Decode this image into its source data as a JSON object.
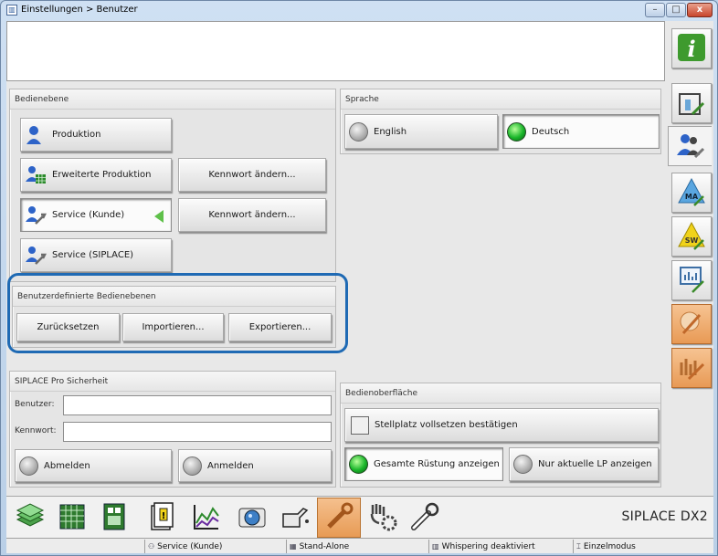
{
  "window": {
    "title": "Einstellungen > Benutzer",
    "icon": "app-icon",
    "controls": {
      "minimize": "–",
      "maximize": "□",
      "close": "x"
    }
  },
  "operator_level": {
    "title": "Bedienebene",
    "buttons": [
      {
        "label": "Produktion",
        "icon": "user-icon"
      },
      {
        "label": "Erweiterte Produktion",
        "icon": "user-grid-icon"
      },
      {
        "label": "Service (Kunde)",
        "icon": "user-wrench-icon",
        "selected": true
      },
      {
        "label": "Service (SIPLACE)",
        "icon": "user-wrench-icon"
      }
    ],
    "change_password_1": "Kennwort ändern...",
    "change_password_2": "Kennwort ändern..."
  },
  "custom_levels": {
    "title": "Benutzerdefinierte Bedienebenen",
    "reset": "Zurücksetzen",
    "import": "Importieren...",
    "export": "Exportieren..."
  },
  "language": {
    "title": "Sprache",
    "english": "English",
    "german": "Deutsch",
    "selected": "Deutsch"
  },
  "security": {
    "title": "SIPLACE Pro Sicherheit",
    "user_label": "Benutzer:",
    "user_value": "",
    "password_label": "Kennwort:",
    "password_value": "",
    "logout": "Abmelden",
    "login": "Anmelden"
  },
  "ui_panel": {
    "title": "Bedienoberfläche",
    "confirm_slot": "Stellplatz vollsetzen bestätigen",
    "show_all": "Gesamte Rüstung anzeigen",
    "show_current": "Nur aktuelle LP anzeigen",
    "selected": "Gesamte Rüstung anzeigen"
  },
  "sidebar": {
    "tabs": [
      {
        "icon": "info-icon"
      },
      {
        "icon": "machine-tool-icon"
      },
      {
        "icon": "users-gear-icon",
        "active": true
      },
      {
        "icon": "ma-triangle-icon",
        "text": "MA"
      },
      {
        "icon": "sw-triangle-icon",
        "text": "SW"
      },
      {
        "icon": "monitor-chart-icon"
      },
      {
        "icon": "wrench-plate-icon",
        "accent": "#e89a55"
      },
      {
        "icon": "wrench-bars-icon",
        "accent": "#e89a55"
      }
    ]
  },
  "toolbar": {
    "tools": [
      "stack-icon",
      "grid-table-icon",
      "module-icon",
      "clipboard-warning-icon",
      "line-chart-icon",
      "camera-icon",
      "oil-can-icon",
      "wrench-icon",
      "hand-gear-icon",
      "wrench-outline-icon"
    ],
    "active_tool": "wrench-icon",
    "brand": "SIPLACE DX2"
  },
  "status": {
    "level": "Service (Kunde)",
    "mode": "Stand-Alone",
    "whispering": "Whispering deaktiviert",
    "single_mode": "Einzelmodus"
  },
  "colors": {
    "highlight": "#1f6ab4",
    "led_on": "#19b62a",
    "accent_orange": "#e89a55"
  }
}
